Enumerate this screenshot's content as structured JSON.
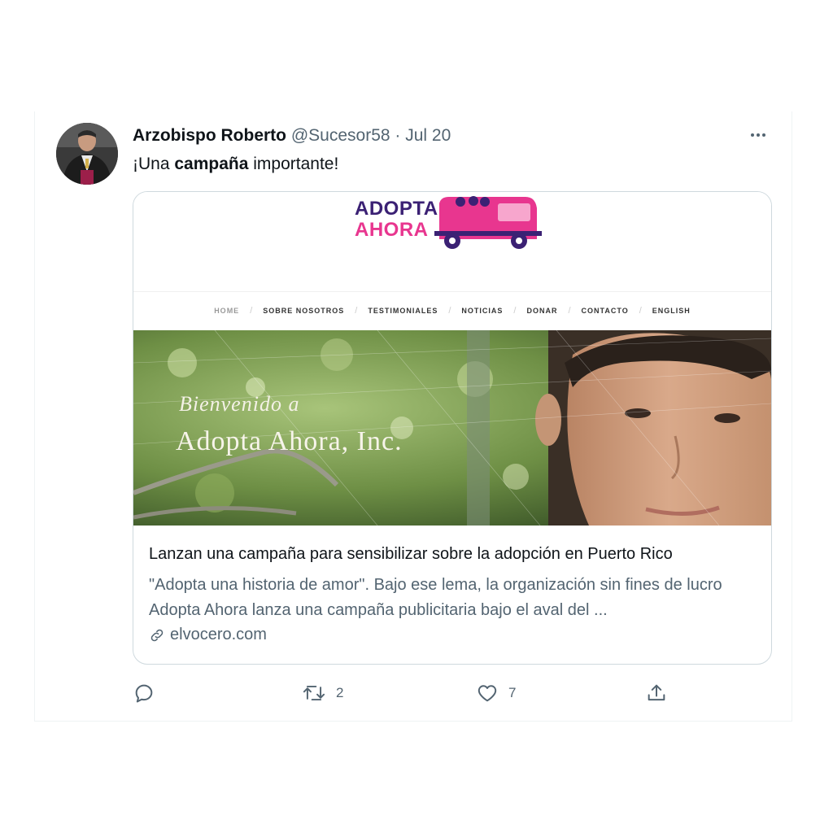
{
  "tweet": {
    "author_name": "Arzobispo Roberto",
    "handle": "@Sucesor58",
    "separator": "·",
    "date": "Jul 20",
    "text_pre": "¡Una ",
    "text_bold": "campaña",
    "text_post": " importante!"
  },
  "card": {
    "logo_line1": "ADOPTA",
    "logo_line2": "AHORA",
    "nav": [
      "HOME",
      "SOBRE NOSOTROS",
      "TESTIMONIALES",
      "NOTICIAS",
      "DONAR",
      "CONTACTO",
      "ENGLISH"
    ],
    "hero_line1": "Bienvenido a",
    "hero_line2": "Adopta Ahora, Inc.",
    "title": "Lanzan una campaña para sensibilizar sobre la adopción en Puerto Rico",
    "description": "\"Adopta una historia de amor\". Bajo ese lema, la organización sin fines de lucro Adopta Ahora lanza una campaña publicitaria bajo el aval del ...",
    "domain": "elvocero.com"
  },
  "actions": {
    "reply_icon": "reply-icon",
    "retweet_icon": "retweet-icon",
    "retweet_count": "2",
    "like_icon": "heart-icon",
    "like_count": "7",
    "share_icon": "share-icon"
  },
  "colors": {
    "text_primary": "#0f1419",
    "text_secondary": "#536471",
    "border": "#cfd9de",
    "logo_purple": "#3b2174",
    "logo_pink": "#e8368f"
  }
}
